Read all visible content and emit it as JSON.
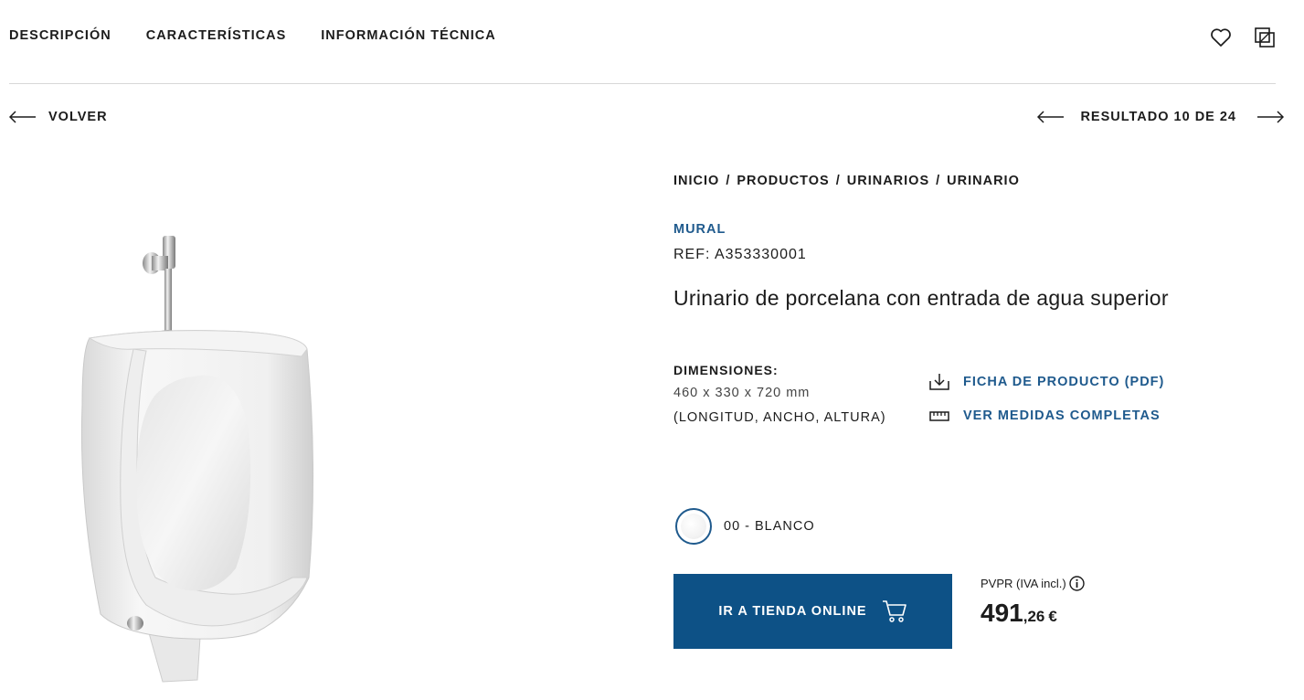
{
  "tabs": [
    {
      "label": "DESCRIPCIÓN"
    },
    {
      "label": "CARACTERÍSTICAS"
    },
    {
      "label": "INFORMACIÓN TÉCNICA"
    }
  ],
  "header_icons": [
    "heart-icon",
    "compare-icon"
  ],
  "nav": {
    "back_label": "VOLVER",
    "results_label": "RESULTADO 10 DE 24"
  },
  "breadcrumb": [
    "INICIO",
    "PRODUCTOS",
    "URINARIOS",
    "URINARIO"
  ],
  "breadcrumb_separator": "/",
  "product": {
    "collection": "MURAL",
    "ref": "REF: A353330001",
    "title": "Urinario de porcelana con entrada de agua superior",
    "dimensions_label": "DIMENSIONES:",
    "dimensions_value": "460 x 330 x 720 mm",
    "dimensions_note": "(LONGITUD, ANCHO, ALTURA)",
    "links": [
      {
        "label": "FICHA DE PRODUCTO (PDF)",
        "icon": "download-icon"
      },
      {
        "label": "VER MEDIDAS COMPLETAS",
        "icon": "ruler-icon"
      }
    ],
    "color_option": "00 - BLANCO",
    "shop_button": "IR A TIENDA ONLINE",
    "price_label": "PVPR (IVA incl.)",
    "price_integer": "491",
    "price_decimal": ",26",
    "currency": "€"
  },
  "colors": {
    "accent": "#1f5a8d",
    "button": "#0d5186",
    "text": "#1c1c1c",
    "divider": "#d7d7d7"
  }
}
